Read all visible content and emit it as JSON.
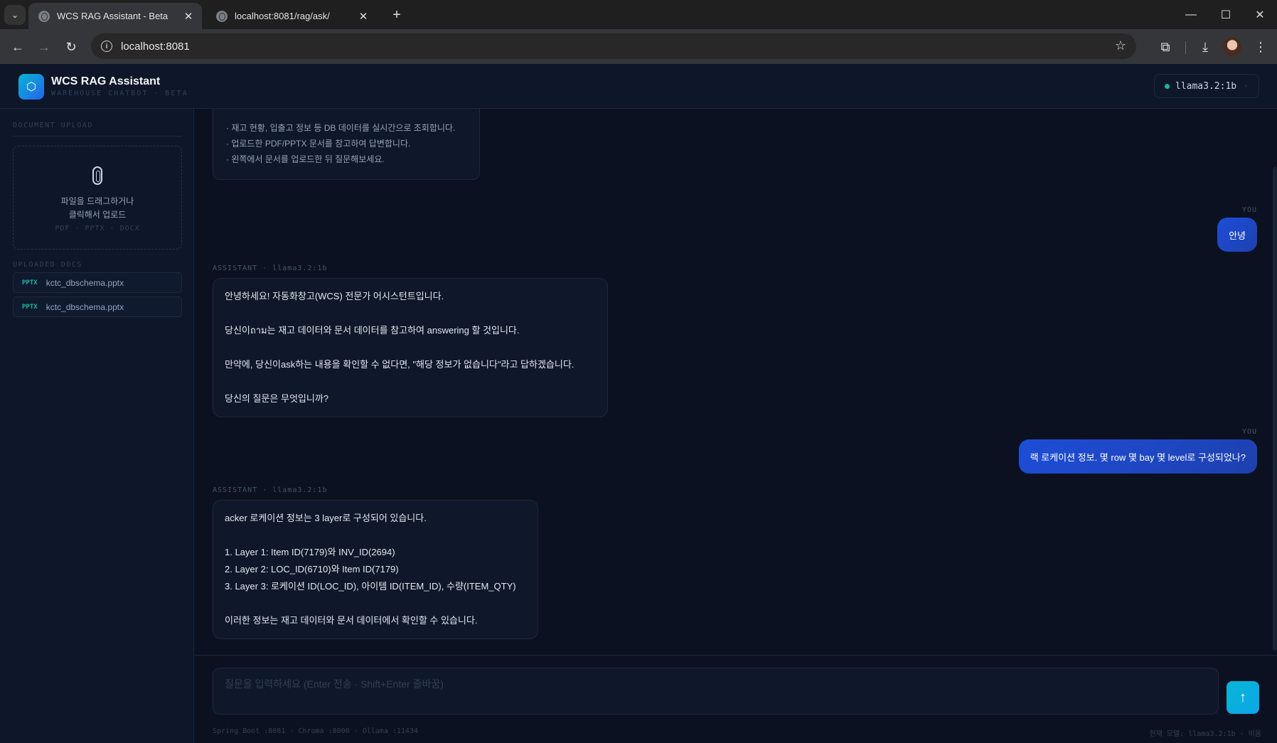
{
  "browser": {
    "tabs": [
      {
        "title": "WCS RAG Assistant - Beta",
        "active": true
      },
      {
        "title": "localhost:8081/rag/ask/",
        "active": false
      }
    ],
    "new_tab": "+",
    "url": "localhost:8081"
  },
  "header": {
    "logo_glyph": "⬡",
    "title": "WCS RAG Assistant",
    "subtitle": "WAREHOUSE CHATBOT · BETA",
    "model": "llama3.2:1b",
    "model_caret": "·"
  },
  "sidebar": {
    "upload_section": "DOCUMENT UPLOAD",
    "drop_line1": "파일을 드래그하거나",
    "drop_line2": "클릭해서 업로드",
    "drop_types": "PDF · PPTX · DOCX",
    "docs_section": "UPLOADED DOCS",
    "docs": [
      {
        "type": "PPTX",
        "name": "kctc_dbschema.pptx"
      },
      {
        "type": "PPTX",
        "name": "kctc_dbschema.pptx"
      }
    ]
  },
  "chat": {
    "welcome_lines": [
      "· 재고 현황, 입출고 정보 등 DB 데이터를 실시간으로 조회합니다.",
      "· 업로드한 PDF/PPTX 문서를 참고하여 답변합니다.",
      "· 왼쪽에서 문서를 업로드한 뒤 질문해보세요."
    ],
    "messages": [
      {
        "role": "user",
        "label": "YOU",
        "text": "안녕"
      },
      {
        "role": "assistant",
        "label": "ASSISTANT · llama3.2:1b",
        "lines": [
          "안녕하세요! 자동화창고(WCS) 전문가 어시스턴트입니다.",
          "",
          "당신이ถาม는 재고 데이터와 문서 데이터를 참고하여 answering 할 것입니다.",
          "",
          "만약에, 당신이ask하는 내용을 확인할 수 없다면, \"해당 정보가 없습니다\"라고 답하겠습니다.",
          "",
          "당신의 질문은 무엇입니까?"
        ]
      },
      {
        "role": "user",
        "label": "YOU",
        "text": "랙 로케이션 정보. 몇 row 몇 bay 몇 level로 구성되었나?"
      },
      {
        "role": "assistant",
        "label": "ASSISTANT · llama3.2:1b",
        "lines": [
          "acker 로케이션 정보는 3 layer로 구성되어 있습니다.",
          "",
          "1. Layer 1: Item ID(7179)와 INV_ID(2694)",
          "2. Layer 2: LOC_ID(6710)와 Item ID(7179)",
          "3. Layer 3: 로케이션 ID(LOC_ID), 아이템 ID(ITEM_ID), 수량(ITEM_QTY)",
          "",
          "이러한 정보는 재고 데이터와 문서 데이터에서 확인할 수 있습니다."
        ]
      }
    ]
  },
  "input": {
    "placeholder": "질문을 입력하세요 (Enter 전송 · Shift+Enter 줄바꿈)",
    "send_glyph": "↑",
    "footer_left": "Spring Boot :8081 · Chroma :8000 · Ollama :11434",
    "footer_right": "현재 모델: llama3.2:1b · 비움"
  },
  "colors": {
    "background": "#0b1120",
    "accent": "#06b6d4",
    "user_bubble": "#1d4ed8",
    "status_dot": "#14b8a6"
  }
}
